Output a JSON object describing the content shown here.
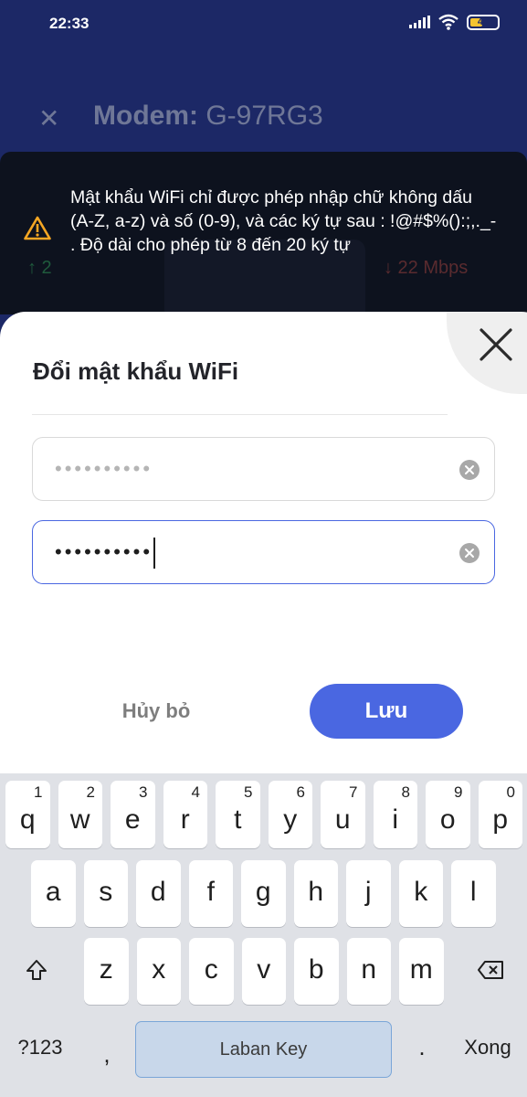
{
  "status_bar": {
    "time": "22:33",
    "battery": "40"
  },
  "background_app": {
    "close_icon": "close-icon",
    "title_bold": "Modem:",
    "title_model": "G-97RG3",
    "upload_speed": "↑ 2",
    "download_speed": "↓ 22 Mbps"
  },
  "toast": {
    "icon": "warning-icon",
    "message": "Mật khẩu WiFi chỉ được phép nhập chữ không dấu (A-Z, a-z) và số (0-9), và các ký tự sau : !@#$%():;,._- . Độ dài cho phép từ 8 đến 20 ký tự",
    "accent_color": "#f5a623"
  },
  "dialog": {
    "title": "Đổi mật khẩu WiFi",
    "password_field_1": "••••••••••",
    "password_field_2": "••••••••••",
    "cancel_label": "Hủy bỏ",
    "save_label": "Lưu",
    "accent_color": "#4a67e1"
  },
  "keyboard": {
    "row1": [
      {
        "ch": "q",
        "hint": "1"
      },
      {
        "ch": "w",
        "hint": "2"
      },
      {
        "ch": "e",
        "hint": "3"
      },
      {
        "ch": "r",
        "hint": "4"
      },
      {
        "ch": "t",
        "hint": "5"
      },
      {
        "ch": "y",
        "hint": "6"
      },
      {
        "ch": "u",
        "hint": "7"
      },
      {
        "ch": "i",
        "hint": "8"
      },
      {
        "ch": "o",
        "hint": "9"
      },
      {
        "ch": "p",
        "hint": "0"
      }
    ],
    "row2": [
      "a",
      "s",
      "d",
      "f",
      "g",
      "h",
      "j",
      "k",
      "l"
    ],
    "row3": [
      "z",
      "x",
      "c",
      "v",
      "b",
      "n",
      "m"
    ],
    "numbers_label": "?123",
    "comma_label": ",",
    "space_label": "Laban Key",
    "period_label": ".",
    "done_label": "Xong"
  }
}
